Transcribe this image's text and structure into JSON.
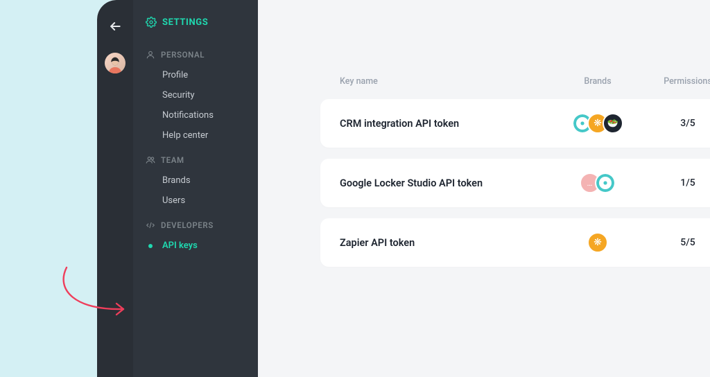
{
  "colors": {
    "accent": "#1fd9b0"
  },
  "header": {
    "settings_label": "SETTINGS"
  },
  "sidebar": {
    "sections": [
      {
        "label": "PERSONAL",
        "icon": "user-icon",
        "items": [
          {
            "label": "Profile"
          },
          {
            "label": "Security"
          },
          {
            "label": "Notifications"
          },
          {
            "label": "Help center"
          }
        ]
      },
      {
        "label": "TEAM",
        "icon": "users-icon",
        "items": [
          {
            "label": "Brands"
          },
          {
            "label": "Users"
          }
        ]
      },
      {
        "label": "DEVELOPERS",
        "icon": "code-icon",
        "items": [
          {
            "label": "API keys",
            "active": true
          }
        ]
      }
    ]
  },
  "table": {
    "headers": {
      "name": "Key name",
      "brands": "Brands",
      "permissions": "Permissions"
    },
    "rows": [
      {
        "name": "CRM integration API token",
        "brands": [
          "teal",
          "orange",
          "dark"
        ],
        "permissions": "3/5"
      },
      {
        "name": "Google Locker Studio API token",
        "brands": [
          "pink",
          "teal"
        ],
        "permissions": "1/5"
      },
      {
        "name": "Zapier API token",
        "brands": [
          "orange"
        ],
        "permissions": "5/5"
      }
    ]
  }
}
